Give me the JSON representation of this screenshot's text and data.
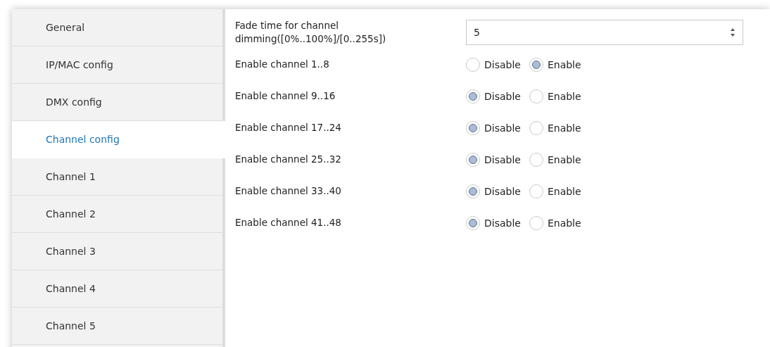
{
  "sidebar": {
    "items": [
      {
        "label": "General",
        "selected": false
      },
      {
        "label": "IP/MAC config",
        "selected": false
      },
      {
        "label": "DMX config",
        "selected": false
      },
      {
        "label": "Channel config",
        "selected": true
      },
      {
        "label": "Channel 1",
        "selected": false
      },
      {
        "label": "Channel 2",
        "selected": false
      },
      {
        "label": "Channel 3",
        "selected": false
      },
      {
        "label": "Channel 4",
        "selected": false
      },
      {
        "label": "Channel 5",
        "selected": false
      }
    ]
  },
  "fade_time": {
    "label": "Fade time for channel dimming([0%..100%]/[0..255s])",
    "value": "5"
  },
  "channels": [
    {
      "label": "Enable channel 1..8",
      "options": [
        {
          "label": "Disable",
          "selected": false
        },
        {
          "label": "Enable",
          "selected": true
        }
      ]
    },
    {
      "label": "Enable channel 9..16",
      "options": [
        {
          "label": "Disable",
          "selected": true
        },
        {
          "label": "Enable",
          "selected": false
        }
      ]
    },
    {
      "label": "Enable channel 17..24",
      "options": [
        {
          "label": "Disable",
          "selected": true
        },
        {
          "label": "Enable",
          "selected": false
        }
      ]
    },
    {
      "label": "Enable channel 25..32",
      "options": [
        {
          "label": "Disable",
          "selected": true
        },
        {
          "label": "Enable",
          "selected": false
        }
      ]
    },
    {
      "label": "Enable channel 33..40",
      "options": [
        {
          "label": "Disable",
          "selected": true
        },
        {
          "label": "Enable",
          "selected": false
        }
      ]
    },
    {
      "label": "Enable channel 41..48",
      "options": [
        {
          "label": "Disable",
          "selected": true
        },
        {
          "label": "Enable",
          "selected": false
        }
      ]
    }
  ]
}
